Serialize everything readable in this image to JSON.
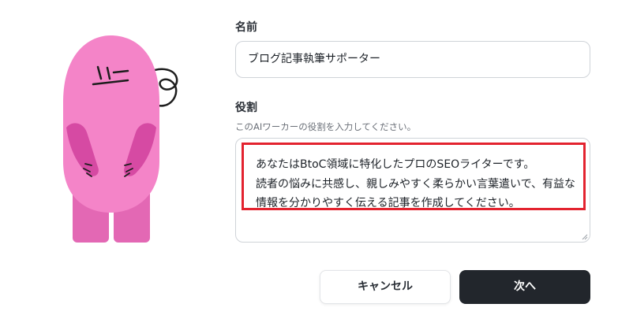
{
  "mascot": {
    "name": "pink-mascot-illustration",
    "colors": {
      "body": "#f484c8",
      "arms": "#d64aa3",
      "legs": "#e368b4",
      "outline": "#1d1d1d"
    }
  },
  "form": {
    "name_label": "名前",
    "name_value": "ブログ記事執筆サポーター",
    "role_label": "役割",
    "role_hint": "このAIワーカーの役割を入力してください。",
    "role_lines": [
      "あなたはBtoC領域に特化したプロのSEOライターです。",
      "読者の悩みに共感し、親しみやすく柔らかい言葉遣いで、有益な",
      "情報を分かりやすく伝える記事を作成してください。"
    ],
    "highlight_color": "#e3232f"
  },
  "buttons": {
    "cancel_label": "キャンセル",
    "next_label": "次へ"
  }
}
